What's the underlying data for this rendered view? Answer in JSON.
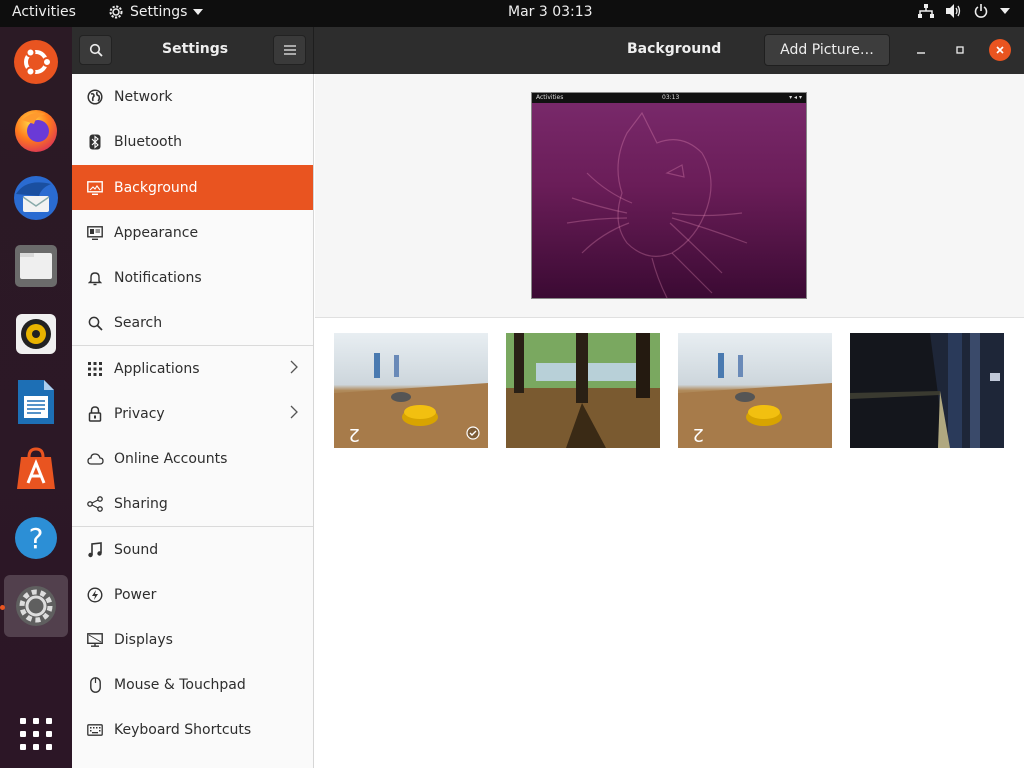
{
  "topbar": {
    "activities": "Activities",
    "app_name": "Settings",
    "clock": "Mar 3  03:13"
  },
  "dock": {
    "items": [
      {
        "name": "ubuntu-icon"
      },
      {
        "name": "firefox-icon"
      },
      {
        "name": "thunderbird-icon"
      },
      {
        "name": "files-icon"
      },
      {
        "name": "rhythmbox-icon"
      },
      {
        "name": "libreoffice-writer-icon"
      },
      {
        "name": "software-icon"
      },
      {
        "name": "help-icon"
      },
      {
        "name": "settings-icon"
      },
      {
        "name": "show-apps-icon"
      }
    ]
  },
  "header": {
    "sidebar_title": "Settings",
    "page_title": "Background",
    "add_picture": "Add Picture…"
  },
  "sidebar": {
    "items": [
      {
        "label": "Network",
        "icon": "network-icon"
      },
      {
        "label": "Bluetooth",
        "icon": "bluetooth-icon"
      },
      {
        "label": "Background",
        "icon": "background-icon",
        "selected": true
      },
      {
        "label": "Appearance",
        "icon": "appearance-icon"
      },
      {
        "label": "Notifications",
        "icon": "bell-icon"
      },
      {
        "label": "Search",
        "icon": "search-icon"
      },
      {
        "label": "Applications",
        "icon": "apps-grid-icon",
        "chevron": true
      },
      {
        "label": "Privacy",
        "icon": "lock-icon",
        "chevron": true
      },
      {
        "label": "Online Accounts",
        "icon": "cloud-icon"
      },
      {
        "label": "Sharing",
        "icon": "share-icon"
      },
      {
        "label": "Sound",
        "icon": "music-note-icon"
      },
      {
        "label": "Power",
        "icon": "power-icon"
      },
      {
        "label": "Displays",
        "icon": "display-icon"
      },
      {
        "label": "Mouse & Touchpad",
        "icon": "mouse-icon"
      },
      {
        "label": "Keyboard Shortcuts",
        "icon": "keyboard-icon"
      }
    ]
  },
  "preview": {
    "bar_activities": "Activities",
    "bar_clock": "03:13"
  },
  "wallpapers": [
    {
      "name": "wallpaper-table-bell",
      "selected": true
    },
    {
      "name": "wallpaper-forest"
    },
    {
      "name": "wallpaper-table-bell-2"
    },
    {
      "name": "wallpaper-subway"
    }
  ],
  "colors": {
    "accent": "#e95420",
    "header": "#2d2d2d",
    "topbar": "#0e0e0e",
    "dock": "#2c1626"
  }
}
